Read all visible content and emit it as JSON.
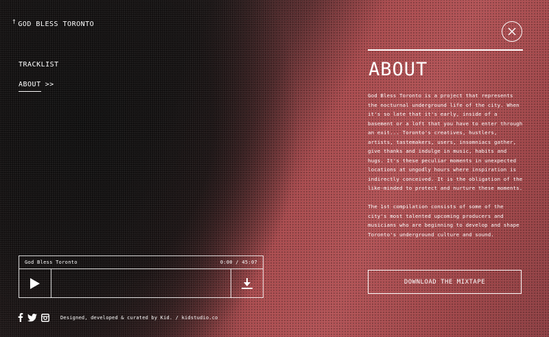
{
  "site": {
    "logo_mark": "†",
    "logo_text": "GOD BLESS TORONTO"
  },
  "nav": {
    "items": [
      {
        "label": "TRACKLIST"
      },
      {
        "label": "ABOUT",
        "arrows": ">>"
      }
    ]
  },
  "player": {
    "track_title": "God Bless Toronto",
    "time": "0:00 / 45:07",
    "play_icon": "play-icon",
    "download_icon": "download-icon"
  },
  "footer": {
    "social_icons": [
      "facebook-icon",
      "twitter-icon",
      "instagram-icon"
    ],
    "credit": "Designed, developed & curated by Kid. / kidstudio.co"
  },
  "about": {
    "title": "ABOUT",
    "paragraphs": [
      "God Bless Toronto is a project that represents the nocturnal underground life of the city. When it's so late that it's early, inside of a basement or a loft that you have to enter through an exit... Toronto's creatives, hustlers, artists, tastemakers, users, insomniacs gather, give thanks and indulge in music, habits and hugs. It's these peculiar moments in unexpected locations at ungodly hours where inspiration is indirectly conceived. It is the obligation of the like-minded to protect and nurture these moments.",
      "The 1st compilation consists of some of the city's most talented upcoming producers and musicians who are beginning to develop and shape Toronto's underground culture and sound."
    ],
    "download_label": "DOWNLOAD THE MIXTAPE",
    "close_icon": "close-icon"
  },
  "colors": {
    "text": "#ffffff",
    "dark_bg": "#1c1616",
    "accent_red": "#a8474a"
  }
}
